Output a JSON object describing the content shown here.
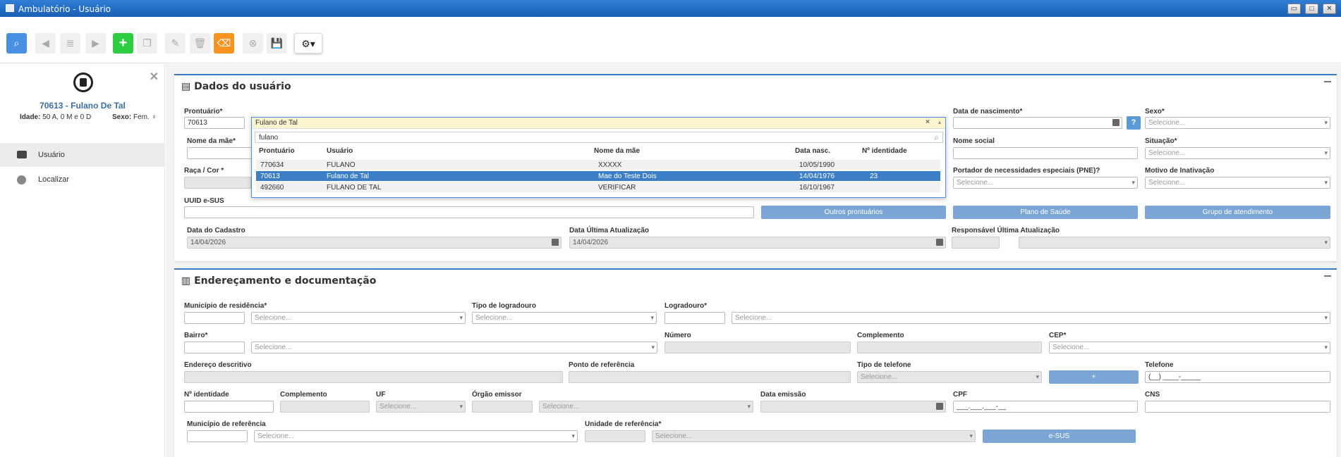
{
  "window": {
    "title": "Ambulatório - Usuário",
    "minimize": "▭",
    "maximize": "□",
    "close": "✕"
  },
  "toolbar": {
    "icons": [
      "search-icon",
      "back-icon",
      "list-icon",
      "forward-icon",
      "add-icon",
      "copy-icon",
      "edit-icon",
      "delete-icon",
      "eraser-icon",
      "cancel-icon",
      "save-icon",
      "gear-icon"
    ],
    "glyphs": {
      "search": "⌕",
      "back": "◀",
      "list": "≣",
      "forward": "▶",
      "add": "+",
      "copy": "❐",
      "edit": "✎",
      "delete": "🗑",
      "eraser": "⌫",
      "cancel": "⊗",
      "save": "💾",
      "gear": "⚙▾"
    }
  },
  "sidebar": {
    "patient_title": "70613 - Fulano De Tal",
    "age_label": "Idade:",
    "age_value": "50 A, 0 M e 0 D",
    "sex_label": "Sexo:",
    "sex_value": "Fem.",
    "close": "✕",
    "items": [
      {
        "label": "Usuário",
        "icon": "id-card-icon"
      },
      {
        "label": "Localizar",
        "icon": "fingerprint-icon"
      }
    ]
  },
  "dados": {
    "title": "Dados do usuário",
    "prontuario_label": "Prontuário*",
    "prontuario_value": "70613",
    "usuario_value": "Fulano de Tal",
    "nome_mae_label": "Nome da mãe*",
    "raca_label": "Raça / Cor *",
    "uuid_label": "UUID e-SUS",
    "data_nasc_label": "Data de nascimento*",
    "help": "?",
    "sexo_label": "Sexo*",
    "sexo_value": "Selecione...",
    "nome_social_label": "Nome social",
    "situacao_label": "Situação*",
    "situacao_value": "Selecione...",
    "pne_label": "Portador de necessidades especiais (PNE)?",
    "pne_value": "Selecione...",
    "motivo_label": "Motivo de Inativação",
    "motivo_value": "Selecione...",
    "outros_btn": "Outros prontuários",
    "plano_btn": "Plano de Saúde",
    "grupo_btn": "Grupo de atendimento",
    "cadastro_label": "Data do Cadastro",
    "cadastro_value": "14/04/2026",
    "atualizacao_label": "Data Última Atualização",
    "atualizacao_value": "14/04/2026",
    "responsavel_label": "Responsável Última Atualização"
  },
  "dropdown": {
    "selected": "Fulano de Tal",
    "clear": "×",
    "search": "fulano",
    "headers": [
      "Prontuário",
      "Usuário",
      "Nome da mãe",
      "Data nasc.",
      "Nº identidade"
    ],
    "rows": [
      [
        "770634",
        "FULANO",
        "XXXXX",
        "10/05/1990",
        ""
      ],
      [
        "70613",
        "Fulano de Tal",
        "Mae do Teste Dois",
        "14/04/1976",
        "23"
      ],
      [
        "492660",
        "FULANO DE TAL",
        "VERIFICAR",
        "16/10/1967",
        ""
      ]
    ]
  },
  "endereco": {
    "title": "Endereçamento e documentação",
    "municipio_label": "Município de residência*",
    "municipio_value": "Selecione...",
    "tipo_log_label": "Tipo de logradouro",
    "tipo_log_value": "Selecione...",
    "logradouro_label": "Logradouro*",
    "logradouro_value": "Selecione...",
    "bairro_label": "Bairro*",
    "bairro_value": "Selecione...",
    "numero_label": "Número",
    "complemento_label": "Complemento",
    "cep_label": "CEP*",
    "cep_value": "Selecione...",
    "end_desc_label": "Endereço descritivo",
    "ponto_label": "Ponto de referência",
    "tipo_tel_label": "Tipo de telefone",
    "tipo_tel_value": "Selecione...",
    "add_btn": "+",
    "telefone_label": "Telefone",
    "telefone_value": "(__) ____-_____",
    "identidade_label": "Nº identidade",
    "compl2_label": "Complemento",
    "uf_label": "UF",
    "uf_value": "Selecione...",
    "orgao_label": "Órgão emissor",
    "orgao_value": "Selecione...",
    "emissao_label": "Data emissão",
    "cpf_label": "CPF",
    "cpf_value": "___.___.___-__",
    "cns_label": "CNS",
    "mun_ref_label": "Município de referência",
    "mun_ref_value": "Selecione...",
    "unid_ref_label": "Unidade de referência*",
    "unid_ref_value": "Selecione...",
    "esus_btn": "e-SUS"
  },
  "colors": {
    "accent": "#3a78c9",
    "highlight": "#3d7fc6",
    "add": "#2ecc40",
    "eraser": "#f7931e",
    "search": "#4a90e2"
  }
}
